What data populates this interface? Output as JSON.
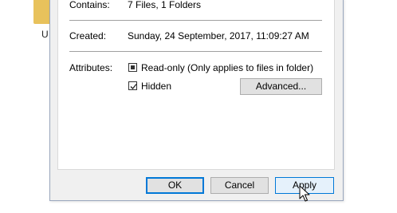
{
  "desktop": {
    "folder_label": "U"
  },
  "dialog": {
    "contains": {
      "label": "Contains:",
      "value": "7 Files, 1 Folders"
    },
    "created": {
      "label": "Created:",
      "value": "Sunday, 24 September, 2017, 11:09:27 AM"
    },
    "attributes": {
      "label": "Attributes:",
      "readonly_label": "Read-only (Only applies to files in folder)",
      "readonly_state": "indeterminate",
      "hidden_label": "Hidden",
      "hidden_state": "checked",
      "advanced_button": "Advanced..."
    },
    "buttons": {
      "ok": "OK",
      "cancel": "Cancel",
      "apply": "Apply"
    }
  },
  "colors": {
    "accent": "#0078d7",
    "dialog_bg": "#f0f0f0",
    "folder": "#e8c25c"
  }
}
